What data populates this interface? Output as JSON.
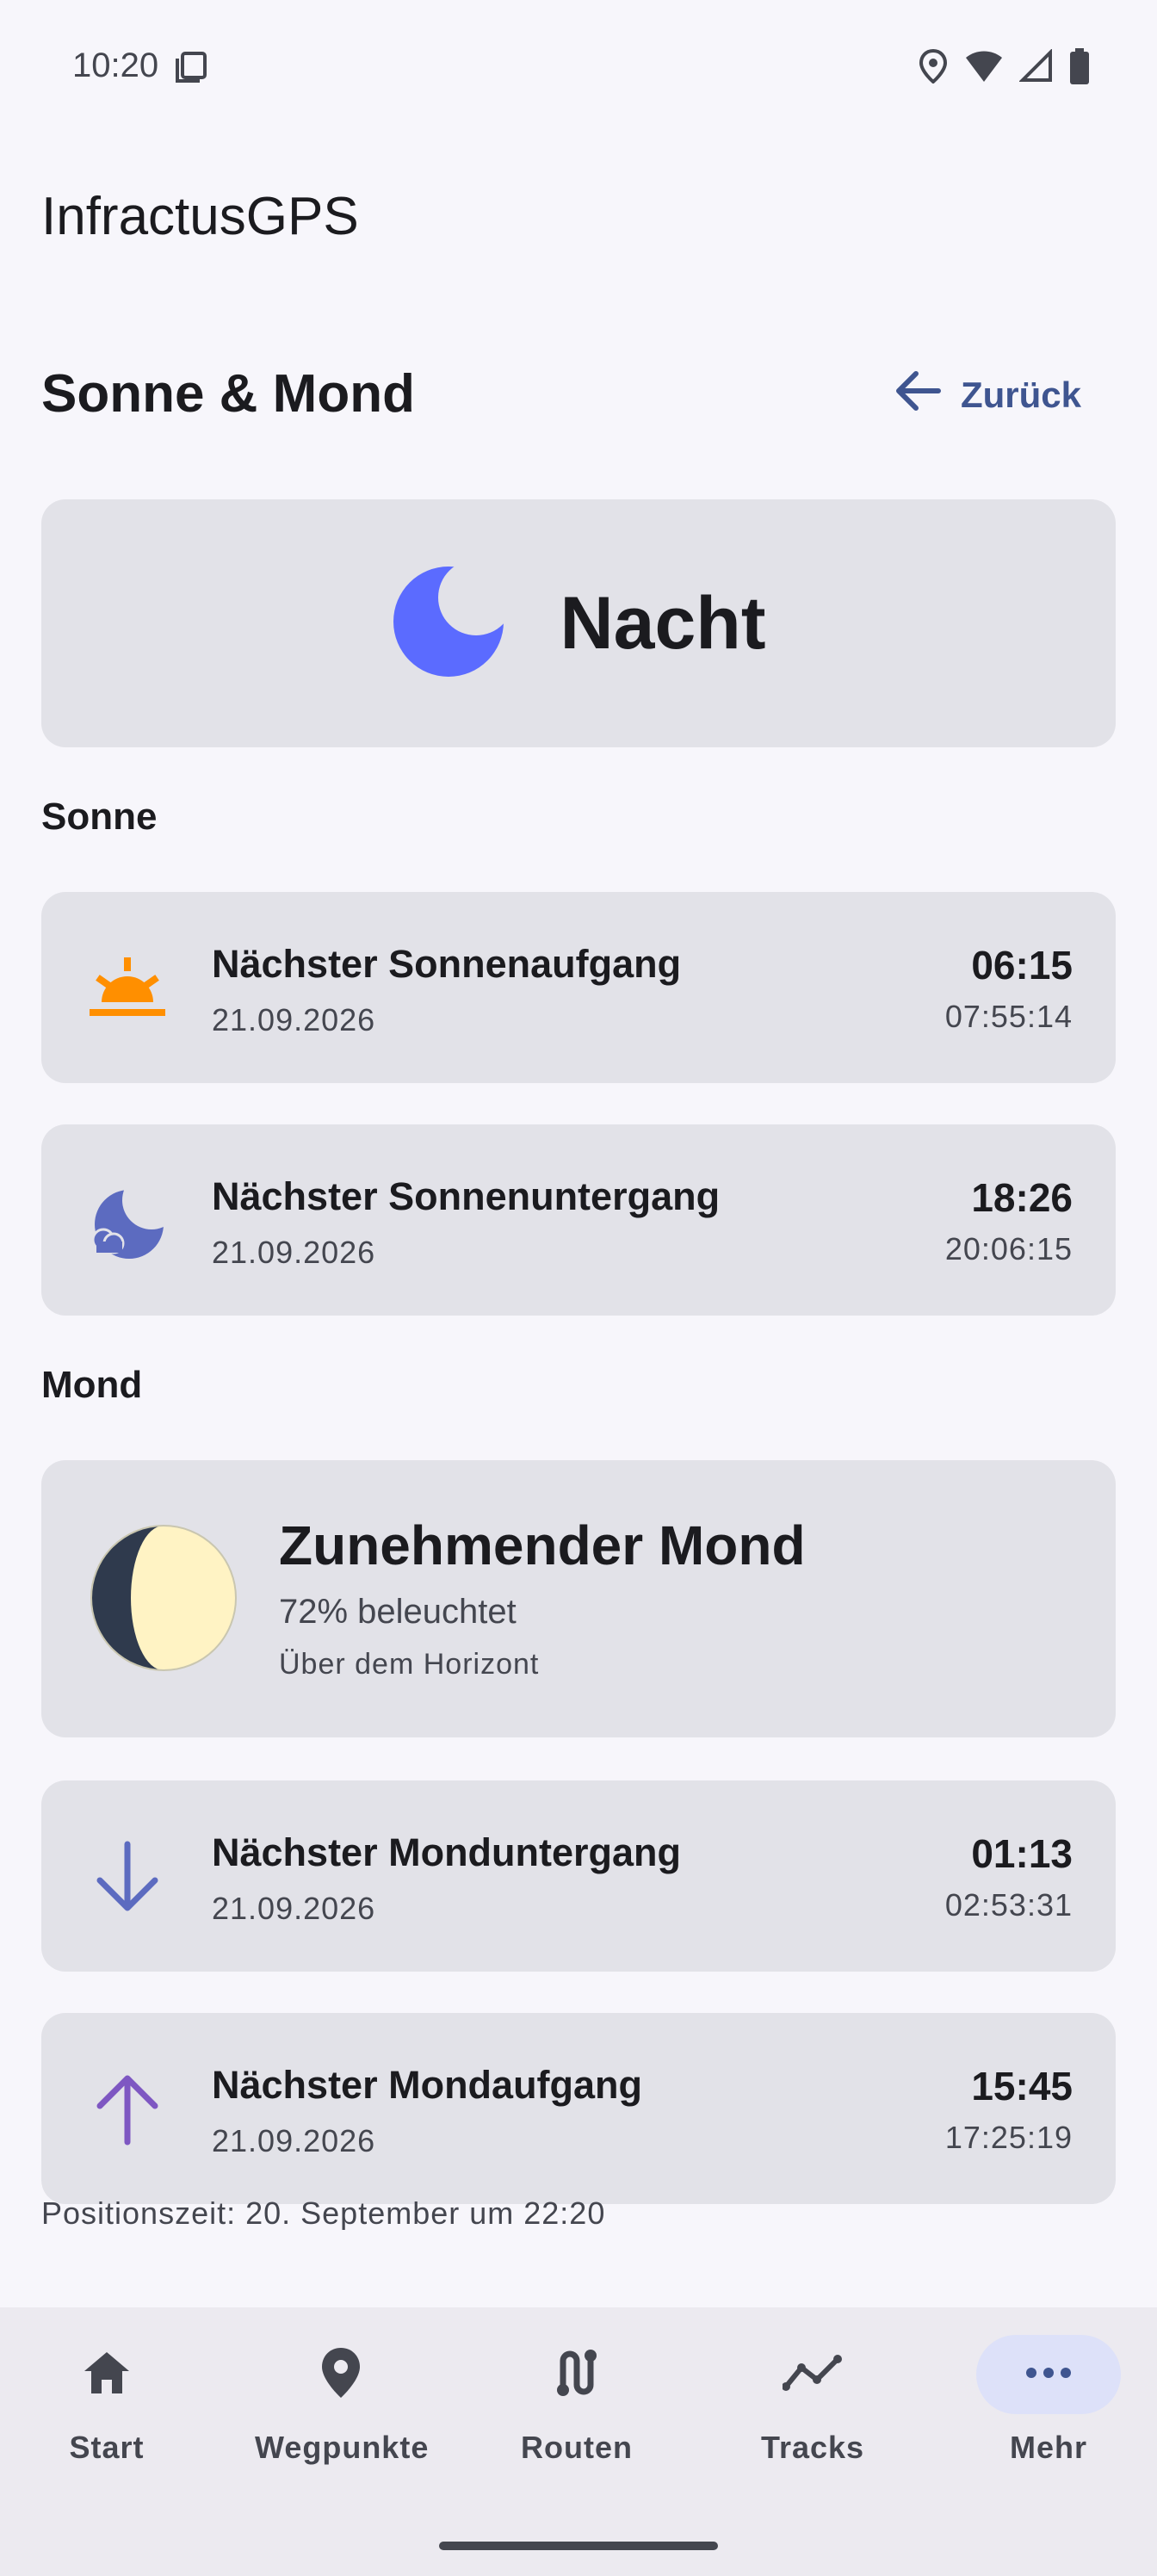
{
  "status_bar": {
    "time": "10:20"
  },
  "app": {
    "title": "InfractusGPS"
  },
  "header": {
    "title": "Sonne & Mond",
    "back_label": "Zurück"
  },
  "day_state": {
    "label": "Nacht",
    "icon": "moon-icon"
  },
  "sun_section": {
    "title": "Sonne",
    "events": [
      {
        "title": "Nächster Sonnenaufgang",
        "date": "21.09.2026",
        "time": "06:15",
        "sub": "07:55:14",
        "icon": "sunrise-icon",
        "color": "#ff8f00"
      },
      {
        "title": "Nächster Sonnenuntergang",
        "date": "21.09.2026",
        "time": "18:26",
        "sub": "20:06:15",
        "icon": "moon-cloud-icon",
        "color": "#5c6bc0"
      }
    ]
  },
  "moon_section": {
    "title": "Mond",
    "phase": {
      "name": "Zunehmender Mond",
      "illumination": "72% beleuchtet",
      "horizon": "Über dem Horizont",
      "illuminated_fraction": 0.72
    },
    "events": [
      {
        "title": "Nächster Monduntergang",
        "date": "21.09.2026",
        "time": "01:13",
        "sub": "02:53:31",
        "icon": "arrow-down-icon",
        "color": "#5c6bc0"
      },
      {
        "title": "Nächster Mondaufgang",
        "date": "21.09.2026",
        "time": "15:45",
        "sub": "17:25:19",
        "icon": "arrow-up-icon",
        "color": "#7e57c2"
      }
    ]
  },
  "position_time": "Positionszeit: 20. September um 22:20",
  "bottom_nav": {
    "items": [
      {
        "label": "Start",
        "icon": "home-icon",
        "active": false
      },
      {
        "label": "Wegpunkte",
        "icon": "location-pin-icon",
        "active": false
      },
      {
        "label": "Routen",
        "icon": "route-icon",
        "active": false
      },
      {
        "label": "Tracks",
        "icon": "tracks-icon",
        "active": false
      },
      {
        "label": "Mehr",
        "icon": "more-icon",
        "active": true
      }
    ]
  },
  "colors": {
    "accent": "#3f5590",
    "card": "#e2e2e8",
    "moon_state": "#5b6bff",
    "moon_lit": "#fff3c4",
    "moon_dark": "#2f3a4d"
  }
}
